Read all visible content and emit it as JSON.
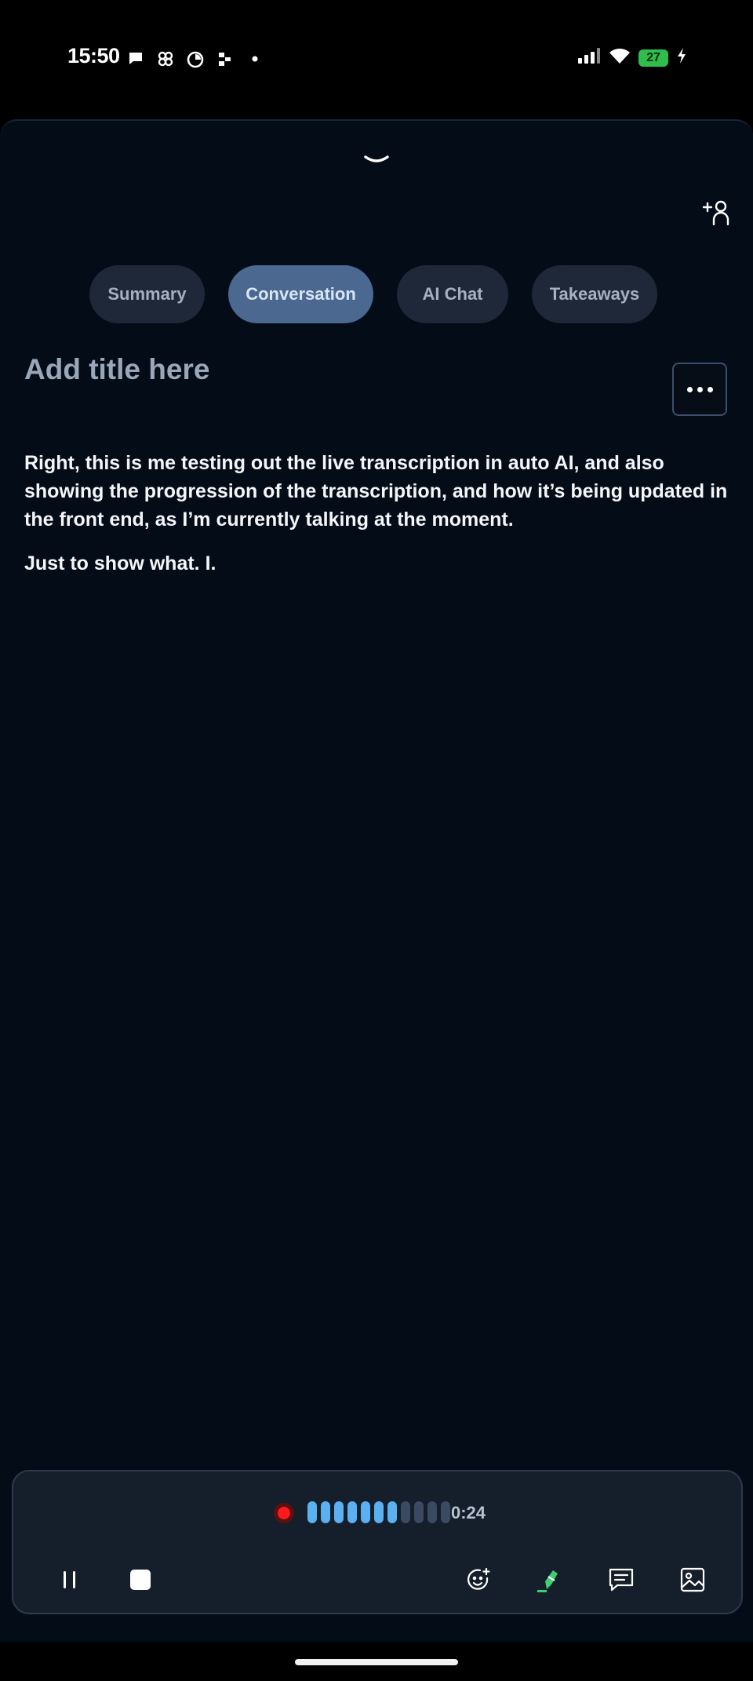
{
  "status_bar": {
    "time": "15:50",
    "battery_level": "27",
    "notification_icons": [
      "chat-bubble-icon",
      "pinwheel-icon",
      "timer-icon",
      "app-icon",
      "dot-icon"
    ],
    "system_icons": [
      "cellular-signal-icon",
      "wifi-icon",
      "battery-charging-icon"
    ]
  },
  "tabs": [
    {
      "label": "Summary",
      "active": false
    },
    {
      "label": "Conversation",
      "active": true
    },
    {
      "label": "AI Chat",
      "active": false
    },
    {
      "label": "Takeaways",
      "active": false
    }
  ],
  "title": {
    "placeholder": "Add title here",
    "value": ""
  },
  "transcript": {
    "paragraphs": [
      "Right, this is me testing out the live transcription in auto AI, and also showing the progression of the transcription, and how it’s being updated in the front end, as I’m currently talking at the moment.",
      "Just to show what. I."
    ]
  },
  "recording": {
    "elapsed": "0:24",
    "level_total_bars": 11,
    "level_active_bars": 7,
    "controls": [
      "pause-icon",
      "stop-icon",
      "emoji-icon",
      "highlighter-icon",
      "comment-icon",
      "image-icon"
    ]
  },
  "colors": {
    "background": "#040c17",
    "active_tab": "#4a6890",
    "inactive_tab": "#1e2838",
    "recording_red": "#ff1a1a",
    "level_active": "#5ab0f0"
  }
}
